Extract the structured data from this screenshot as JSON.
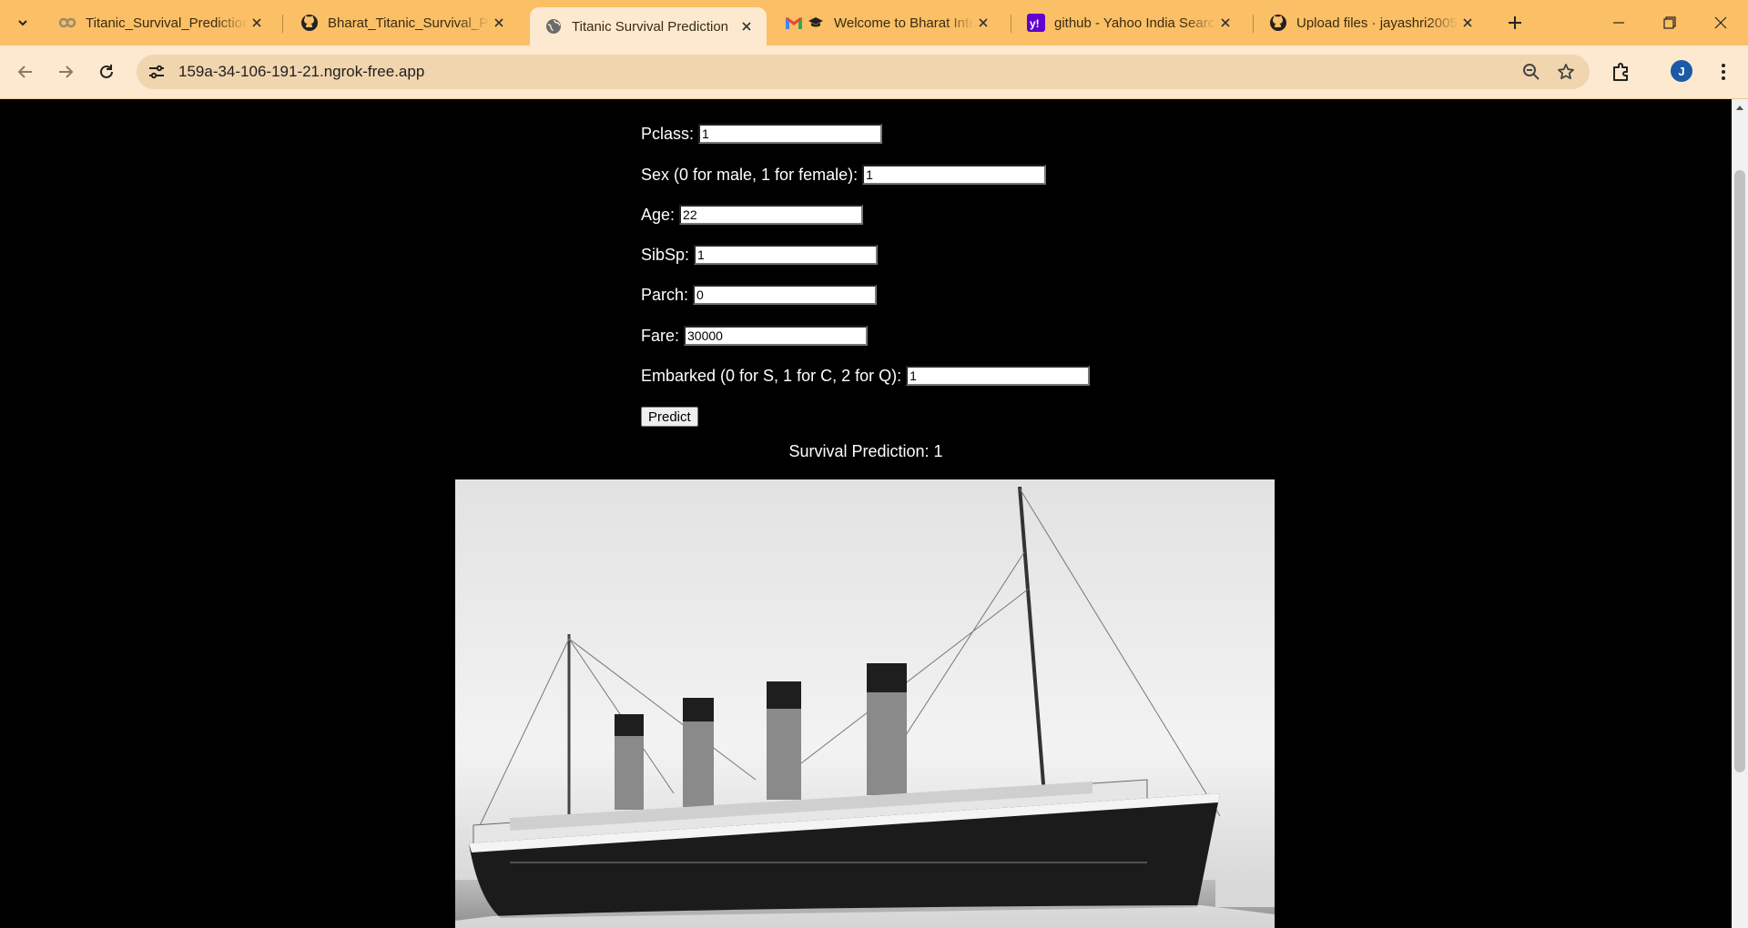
{
  "browser": {
    "tabs": [
      {
        "title": "Titanic_Survival_Prediction",
        "icon": "colab-icon",
        "active": false
      },
      {
        "title": "Bharat_Titanic_Survival_Pre",
        "icon": "github-icon",
        "active": false
      },
      {
        "title": "Titanic Survival Prediction",
        "icon": "globe-icon",
        "active": true
      },
      {
        "title": "Welcome to Bharat Inte",
        "icon": "gmail-icon",
        "active": false
      },
      {
        "title": "github - Yahoo India Searc",
        "icon": "yahoo-icon",
        "active": false
      },
      {
        "title": "Upload files · jayashri2005",
        "icon": "github-icon",
        "active": false
      }
    ],
    "url": "159a-34-106-191-21.ngrok-free.app",
    "profile_initial": "J"
  },
  "form": {
    "fields": [
      {
        "label": "Pclass:",
        "value": "1"
      },
      {
        "label": "Sex (0 for male, 1 for female):",
        "value": "1"
      },
      {
        "label": "Age:",
        "value": "22"
      },
      {
        "label": "SibSp:",
        "value": "1"
      },
      {
        "label": "Parch:",
        "value": "0"
      },
      {
        "label": "Fare:",
        "value": "30000"
      },
      {
        "label": "Embarked (0 for S, 1 for C, 2 for Q):",
        "value": "1"
      }
    ],
    "submit_label": "Predict"
  },
  "result": {
    "text": "Survival Prediction: 1"
  }
}
